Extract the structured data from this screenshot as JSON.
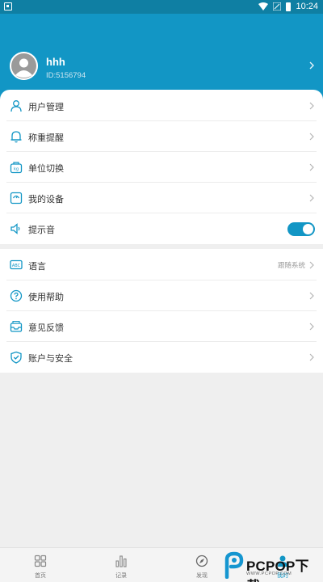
{
  "status_bar": {
    "time": "10:24"
  },
  "profile": {
    "name": "hhh",
    "id": "ID:5156794"
  },
  "menu_group_1": [
    {
      "label": "用户管理",
      "icon": "user-icon"
    },
    {
      "label": "称重提醒",
      "icon": "bell-icon"
    },
    {
      "label": "单位切换",
      "icon": "scale-icon"
    },
    {
      "label": "我的设备",
      "icon": "device-icon"
    },
    {
      "label": "提示音",
      "icon": "speaker-icon",
      "toggle_on": true
    }
  ],
  "menu_group_2": [
    {
      "label": "语言",
      "icon": "language-icon",
      "value": "跟随系统"
    },
    {
      "label": "使用帮助",
      "icon": "help-icon"
    },
    {
      "label": "意见反馈",
      "icon": "feedback-icon"
    },
    {
      "label": "账户与安全",
      "icon": "shield-icon"
    }
  ],
  "tabs": [
    {
      "label": "首页",
      "icon": "home-grid-icon"
    },
    {
      "label": "记录",
      "icon": "bar-chart-icon"
    },
    {
      "label": "发现",
      "icon": "compass-icon"
    },
    {
      "label": "我的",
      "icon": "profile-icon",
      "active": true
    }
  ],
  "watermark": {
    "text": "PCPOP下载",
    "sub": "WWW.PCPOP.COM"
  },
  "colors": {
    "primary": "#1296c5",
    "header_bg": "#1296c5",
    "status_bg": "#0f7fa3"
  }
}
